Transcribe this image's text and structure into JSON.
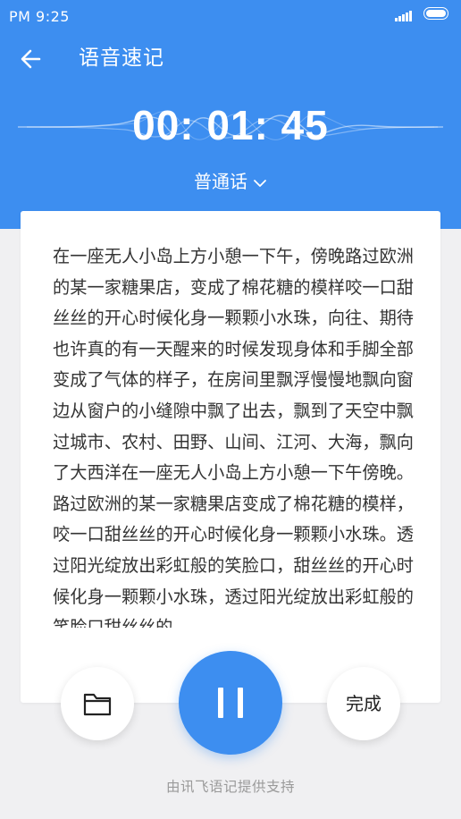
{
  "status_bar": {
    "time": "PM 9:25",
    "icons": [
      "signal-icon",
      "battery-icon"
    ]
  },
  "nav": {
    "back_icon": "back-arrow-icon",
    "title": "语音速记"
  },
  "recorder": {
    "timer": "00: 01: 45",
    "language": "普通话",
    "language_icon": "chevron-down-icon",
    "accent_color": "#3d8ef0"
  },
  "transcript": "在一座无人小岛上方小憩一下午，傍晚路过欧洲的某一家糖果店，变成了棉花糖的模样咬一口甜丝丝的开心时候化身一颗颗小水珠，向往、期待也许真的有一天醒来的时候发现身体和手脚全部变成了气体的样子，在房间里飘浮慢慢地飘向窗边从窗户的小缝隙中飘了出去，飘到了天空中飘过城市、农村、田野、山间、江河、大海，飘向了大西洋在一座无人小岛上方小憩一下午傍晚。路过欧洲的某一家糖果店变成了棉花糖的模样，咬一口甜丝丝的开心时候化身一颗颗小水珠。透过阳光绽放出彩虹般的笑脸口，甜丝丝的开心时候化身一颗颗小水珠，透过阳光绽放出彩虹般的笑脸口甜丝丝的",
  "controls": {
    "folder_icon": "folder-icon",
    "pause_icon": "pause-icon",
    "done_label": "完成"
  },
  "footer": "由讯飞语记提供支持"
}
